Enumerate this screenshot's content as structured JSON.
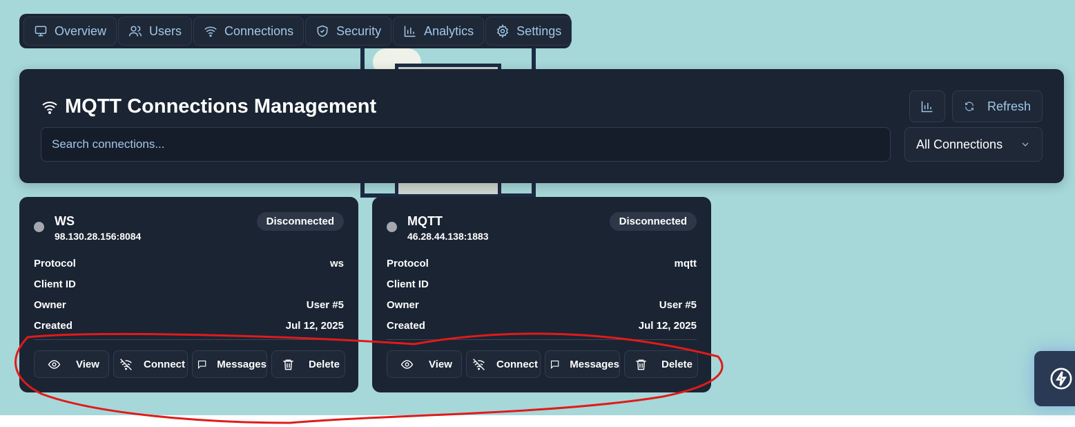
{
  "nav": {
    "tabs": [
      {
        "label": "Overview",
        "icon": "monitor-icon"
      },
      {
        "label": "Users",
        "icon": "users-icon"
      },
      {
        "label": "Connections",
        "icon": "wifi-icon"
      },
      {
        "label": "Security",
        "icon": "shield-check-icon"
      },
      {
        "label": "Analytics",
        "icon": "bar-chart-icon"
      },
      {
        "label": "Settings",
        "icon": "gear-icon"
      }
    ]
  },
  "header": {
    "title": "MQTT Connections Management",
    "refresh_label": "Refresh",
    "search_placeholder": "Search connections...",
    "filter_selected": "All Connections"
  },
  "cards": [
    {
      "name": "WS",
      "address": "98.130.28.156:8084",
      "status": "Disconnected",
      "fields": [
        {
          "label": "Protocol",
          "value": "ws"
        },
        {
          "label": "Client ID",
          "value": ""
        },
        {
          "label": "Owner",
          "value": "User #5"
        },
        {
          "label": "Created",
          "value": "Jul 12, 2025"
        }
      ],
      "actions": {
        "view": "View",
        "connect": "Connect",
        "messages": "Messages",
        "delete": "Delete"
      }
    },
    {
      "name": "MQTT",
      "address": "46.28.44.138:1883",
      "status": "Disconnected",
      "fields": [
        {
          "label": "Protocol",
          "value": "mqtt"
        },
        {
          "label": "Client ID",
          "value": ""
        },
        {
          "label": "Owner",
          "value": "User #5"
        },
        {
          "label": "Created",
          "value": "Jul 12, 2025"
        }
      ],
      "actions": {
        "view": "View",
        "connect": "Connect",
        "messages": "Messages",
        "delete": "Delete"
      }
    }
  ],
  "colors": {
    "background": "#a6d8d9",
    "panel": "#1b2432",
    "accent_text": "#a3c7e6",
    "status_disconnected": "#a4a7b0",
    "annotation_stroke": "#e01b1b"
  }
}
